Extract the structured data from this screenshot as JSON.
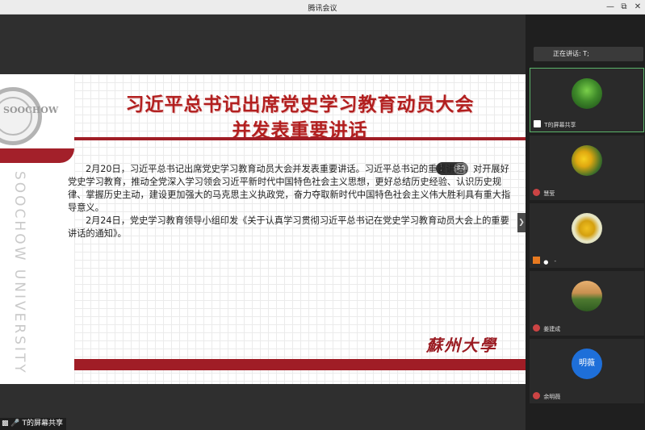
{
  "window": {
    "title": "腾讯会议"
  },
  "slide": {
    "title_line1": "习近平总书记出席党史学习教育动员大会",
    "title_line2": "并发表重要讲话",
    "paragraph1": "2月20日，习近平总书记出席党史学习教育动员大会并发表重要讲话。习近平总书记的重要讲话，对开展好党史学习教育，推动全党深入学习领会习近平新时代中国特色社会主义思想，更好总结历史经验、认识历史规律、掌握历史主动，建设更加强大的马克思主义执政党，奋力夺取新时代中国特色社会主义伟大胜利具有重大指导意义。",
    "paragraph2": "2月24日，党史学习教育领导小组印发《关于认真学习贯彻习近平总书记在党史学习教育动员大会上的重要讲话的通知》。",
    "university_vertical": "SOOCHOW UNIVERSITY",
    "logo_text": "SOOCHOW",
    "calligraphy": "蘇州大學",
    "overlay_value": "80"
  },
  "share_badge": "T的屏幕共享",
  "side": {
    "speaking": "正在讲话: T;",
    "participants": [
      {
        "label": "T的屏幕共享",
        "avatar": "green-sprout-photo"
      },
      {
        "label": "慧莹",
        "avatar": "yellow-flowers-photo"
      },
      {
        "label": "-",
        "avatar": "sunflower-photo"
      },
      {
        "label": "姜建成",
        "avatar": "green-hills-photo"
      },
      {
        "label": "余明薇",
        "avatar_text": "明薇",
        "avatar_color": "#1e6fd9"
      }
    ]
  }
}
